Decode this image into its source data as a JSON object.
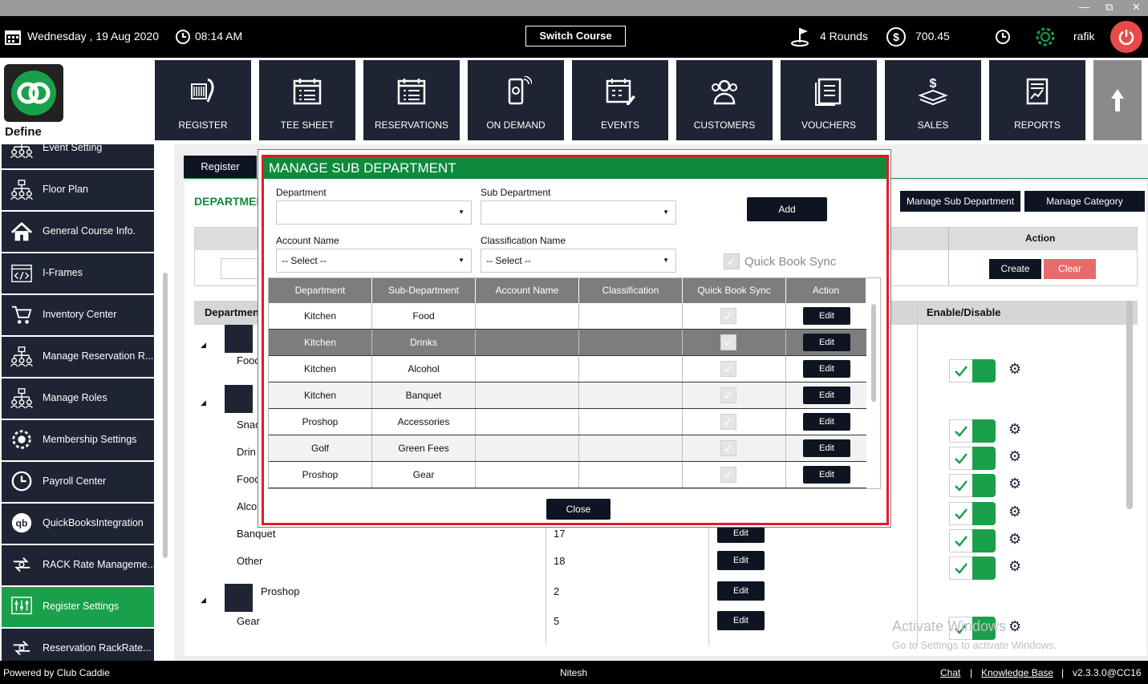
{
  "window": {
    "minimize": "—",
    "restore": "⧉",
    "close": "✕"
  },
  "topbar": {
    "date": "Wednesday ,  19 Aug 2020",
    "time": "08:14 AM",
    "switch_course": "Switch Course",
    "rounds": "4 Rounds",
    "balance": "700.45",
    "user": "rafik"
  },
  "nav": {
    "define_label": "Define",
    "items": [
      {
        "label": "REGISTER",
        "icon": "scanner-icon"
      },
      {
        "label": "TEE SHEET",
        "icon": "calendar-list-icon"
      },
      {
        "label": "RESERVATIONS",
        "icon": "calendar-list-icon"
      },
      {
        "label": "ON DEMAND",
        "icon": "mobile-icon"
      },
      {
        "label": "EVENTS",
        "icon": "calendar-edit-icon"
      },
      {
        "label": "CUSTOMERS",
        "icon": "users-icon"
      },
      {
        "label": "VOUCHERS",
        "icon": "voucher-icon"
      },
      {
        "label": "SALES",
        "icon": "money-icon"
      },
      {
        "label": "REPORTS",
        "icon": "report-icon"
      }
    ]
  },
  "sidebar": {
    "items": [
      {
        "label": "Event Setting",
        "icon": "org-chart-icon"
      },
      {
        "label": "Floor Plan",
        "icon": "org-chart-icon"
      },
      {
        "label": "General Course Info.",
        "icon": "home-icon"
      },
      {
        "label": "I-Frames",
        "icon": "code-icon"
      },
      {
        "label": "Inventory Center",
        "icon": "cart-icon"
      },
      {
        "label": "Manage Reservation R...",
        "icon": "org-chart-icon"
      },
      {
        "label": "Manage Roles",
        "icon": "org-chart-icon"
      },
      {
        "label": "Membership Settings",
        "icon": "settings-icon"
      },
      {
        "label": "Payroll Center",
        "icon": "clock-icon"
      },
      {
        "label": "QuickBooksIntegration",
        "icon": "quickbooks-icon"
      },
      {
        "label": "RACK Rate Manageme...",
        "icon": "exchange-icon"
      },
      {
        "label": "Register Settings",
        "icon": "sliders-icon"
      },
      {
        "label": "Reservation RackRate...",
        "icon": "exchange-icon"
      }
    ]
  },
  "main": {
    "tab_register": "Register",
    "section_title": "DEPARTMEN",
    "manage_sub_department": "Manage Sub Department",
    "manage_category": "Manage Category",
    "action_header": "Action",
    "create": "Create",
    "clear": "Clear",
    "col_department": "Departmen",
    "col_enable": "Enable/Disable",
    "rows": [
      {
        "name": "Food",
        "num": "",
        "indent": true
      },
      {
        "name": "Snac",
        "num": "",
        "indent": true
      },
      {
        "name": "Drin",
        "num": "",
        "indent": true
      },
      {
        "name": "Food",
        "num": "",
        "indent": true
      },
      {
        "name": "Alco",
        "num": "",
        "indent": true
      },
      {
        "name": "Banquet",
        "num": "17",
        "indent": true
      },
      {
        "name": "Other",
        "num": "18",
        "indent": true
      },
      {
        "name": "Proshop",
        "num": "2",
        "indent": false
      },
      {
        "name": "Gear",
        "num": "5",
        "indent": true
      }
    ],
    "edit": "Edit"
  },
  "modal": {
    "title": "MANAGE SUB DEPARTMENT",
    "department_label": "Department",
    "department_value": "",
    "sub_department_label": "Sub Department",
    "sub_department_value": "",
    "add": "Add",
    "account_label": "Account Name",
    "account_value": "-- Select --",
    "classification_label": "Classification Name",
    "classification_value": "-- Select --",
    "quick_book_sync": "Quick Book Sync",
    "headers": [
      "Department",
      "Sub-Department",
      "Account Name",
      "Classification",
      "Quick Book Sync",
      "Action"
    ],
    "rows": [
      {
        "dept": "Kitchen",
        "sub": "Food",
        "account": "",
        "class": "",
        "sync": true,
        "action": "Edit"
      },
      {
        "dept": "Kitchen",
        "sub": "Drinks",
        "account": "",
        "class": "",
        "sync": true,
        "action": "Edit"
      },
      {
        "dept": "Kitchen",
        "sub": "Alcohol",
        "account": "",
        "class": "",
        "sync": true,
        "action": "Edit"
      },
      {
        "dept": "Kitchen",
        "sub": "Banquet",
        "account": "",
        "class": "",
        "sync": true,
        "action": "Edit"
      },
      {
        "dept": "Proshop",
        "sub": "Accessories",
        "account": "",
        "class": "",
        "sync": true,
        "action": "Edit"
      },
      {
        "dept": "Golf",
        "sub": "Green Fees",
        "account": "",
        "class": "",
        "sync": true,
        "action": "Edit"
      },
      {
        "dept": "Proshop",
        "sub": "Gear",
        "account": "",
        "class": "",
        "sync": true,
        "action": "Edit"
      }
    ],
    "close": "Close"
  },
  "watermark": {
    "line1": "Activate Windows",
    "line2": "Go to Settings to activate Windows."
  },
  "footer": {
    "powered": "Powered by Club Caddie",
    "user": "Nitesh",
    "chat": "Chat",
    "sep1": "|",
    "kb": "Knowledge Base",
    "sep2": "|",
    "version": "v2.3.3.0@CC16"
  },
  "colors": {
    "brand_green": "#0d8a3c",
    "nav_dark": "#1e2433",
    "alert_red": "#e21b25",
    "clear_red": "#e86a6a"
  }
}
